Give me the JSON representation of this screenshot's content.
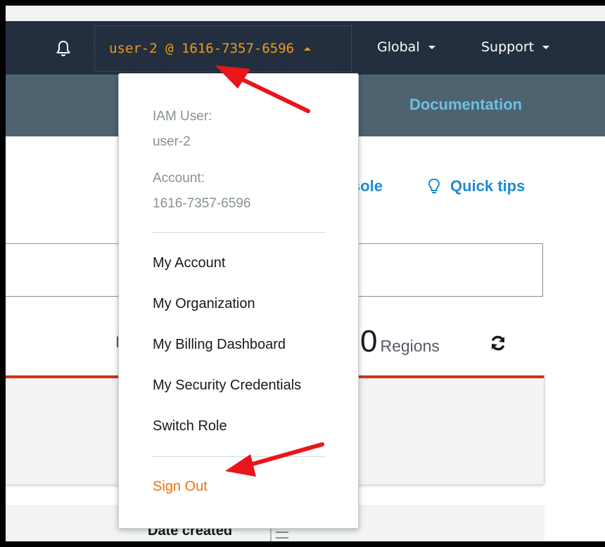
{
  "nav": {
    "user_label": "user-2 @ 1616-7357-6596",
    "region_label": "Global",
    "support_label": "Support"
  },
  "subnav": {
    "documentation_label": "Documentation"
  },
  "toolbar": {
    "console_partial": "sole",
    "quick_tips_label": "Quick tips",
    "regions_count": "0",
    "regions_label": "Regions",
    "hidden_fragment": "I"
  },
  "table": {
    "date_created_header": "Date created"
  },
  "dropdown": {
    "iam_user_label": "IAM User:",
    "iam_user_value": "user-2",
    "account_label": "Account:",
    "account_value": "1616-7357-6596",
    "items": [
      {
        "label": "My Account"
      },
      {
        "label": "My Organization"
      },
      {
        "label": "My Billing Dashboard"
      },
      {
        "label": "My Security Credentials"
      },
      {
        "label": "Switch Role"
      }
    ],
    "sign_out_label": "Sign Out"
  },
  "colors": {
    "nav_bg": "#232f3e",
    "subnav_bg": "#4d6370",
    "accent_orange": "#ec9a1b",
    "sign_out_orange": "#ec7211",
    "link_blue": "#1d8bd1",
    "annotation_red": "#e8151b"
  },
  "icons": {
    "bell": "bell-icon",
    "lightbulb": "lightbulb-icon",
    "refresh": "refresh-icon",
    "column_settings": "column-settings-icon"
  }
}
